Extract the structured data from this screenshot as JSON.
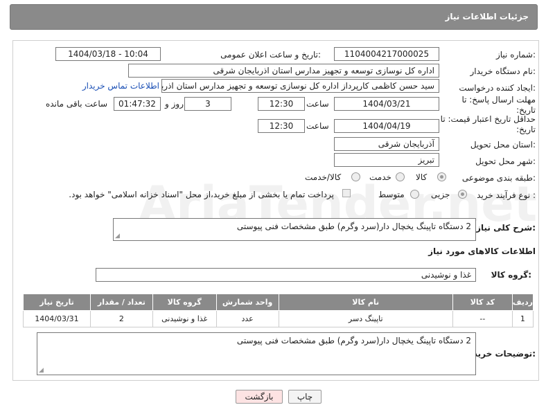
{
  "header": {
    "title": "جزئیات اطلاعات نیاز"
  },
  "form": {
    "need_number_label": "شماره نیاز:",
    "need_number": "1104004217000025",
    "announce_label": "تاریخ و ساعت اعلان عمومی:",
    "announce_value": "1404/03/18 - 10:04",
    "buyer_org_label": "نام دستگاه خریدار:",
    "buyer_org": "اداره کل نوسازی  توسعه و تجهیز مدارس استان اذربایجان شرقی",
    "creator_label": "ایجاد کننده درخواست:",
    "creator": "سید حسن کاظمی کارپرداز اداره کل نوسازی  توسعه و تجهیز مدارس استان اذربایجان شرقی",
    "contact_link": "اطلاعات تماس خریدار",
    "deadline_label": "مهلت ارسال پاسخ: تا تاریخ:",
    "deadline_date": "1404/03/21",
    "time_label": "ساعت",
    "deadline_time": "12:30",
    "days_value": "3",
    "days_label": "روز و",
    "remaining_time": "01:47:32",
    "remaining_label": "ساعت باقی مانده",
    "price_validity_label": "حداقل تاریخ اعتبار قیمت: تا تاریخ:",
    "price_validity_date": "1404/04/19",
    "price_validity_time": "12:30",
    "province_label": "استان محل تحویل:",
    "province": "آذربایجان شرقی",
    "city_label": "شهر محل تحویل:",
    "city": "تبریز",
    "category_label": "طبقه بندی موضوعی:",
    "category_options": [
      "کالا",
      "خدمت",
      "کالا/خدمت"
    ],
    "category_selected": "کالا",
    "process_label": "نوع فرآیند خرید :",
    "process_options": [
      "جزیی",
      "متوسط"
    ],
    "process_selected": "جزیی",
    "payment_note": "پرداخت تمام یا بخشی از مبلغ خرید،از محل \"اسناد خزانه اسلامی\" خواهد بود.",
    "description_label": "شرح کلی نیاز:",
    "description": "2 دستگاه تاپینگ یخچال دار(سرد وگرم) طبق مشخصات فنی پیوستی",
    "goods_info_title": "اطلاعات کالاهای مورد نیاز",
    "goods_group_label": "گروه کالا:",
    "goods_group": "غذا و نوشیدنی"
  },
  "table": {
    "headers": [
      "ردیف",
      "کد کالا",
      "نام کالا",
      "واحد شمارش",
      "گروه کالا",
      "تعداد / مقدار",
      "تاریخ نیاز"
    ],
    "rows": [
      [
        "1",
        "--",
        "تاپینگ دسر",
        "عدد",
        "غذا و نوشیدنی",
        "2",
        "1404/03/31"
      ]
    ]
  },
  "buyer_notes": {
    "label": "توضیحات خریدار:",
    "text": "2 دستگاه تاپینگ یخچال دار(سرد وگرم) طبق مشخصات فنی پیوستی"
  },
  "buttons": {
    "print": "چاپ",
    "back": "بازگشت"
  },
  "watermark": "AriaTender.net",
  "colors": {
    "header_bg": "#8a8a8a",
    "link": "#1a4fb5",
    "back_btn_bg": "#fde3e3"
  }
}
